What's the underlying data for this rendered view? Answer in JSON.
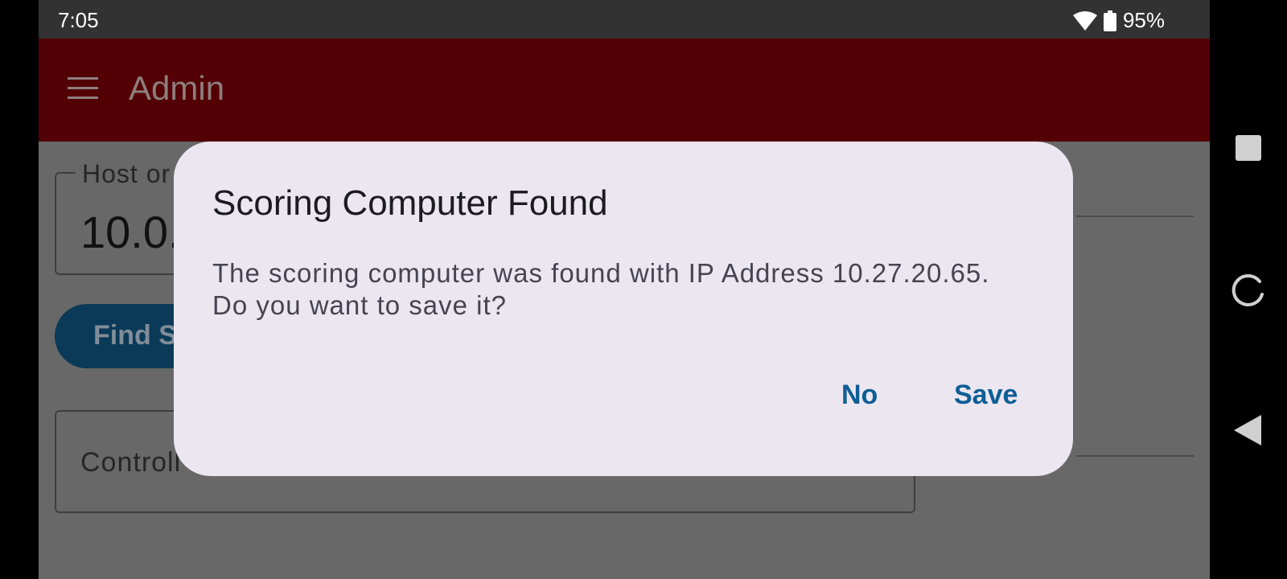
{
  "status_bar": {
    "time": "7:05",
    "battery": "95%",
    "icons": [
      "wifi-icon",
      "battery-icon"
    ]
  },
  "app_bar": {
    "title": "Admin",
    "menu_icon": "menu-icon",
    "color": "#530005"
  },
  "background_form": {
    "host_label": "Host or",
    "host_value": "10.0.",
    "find_button_label": "Find S",
    "control_label": "Controll"
  },
  "dialog": {
    "title": "Scoring Computer Found",
    "message_line1": "The scoring computer was found with IP Address 10.27.20.65.",
    "message_line2": "Do you want to save it?",
    "no_label": "No",
    "save_label": "Save",
    "accent_color": "#0d5e94"
  },
  "nav_bar": {
    "icons": [
      "recents-icon",
      "home-icon",
      "back-icon"
    ]
  }
}
